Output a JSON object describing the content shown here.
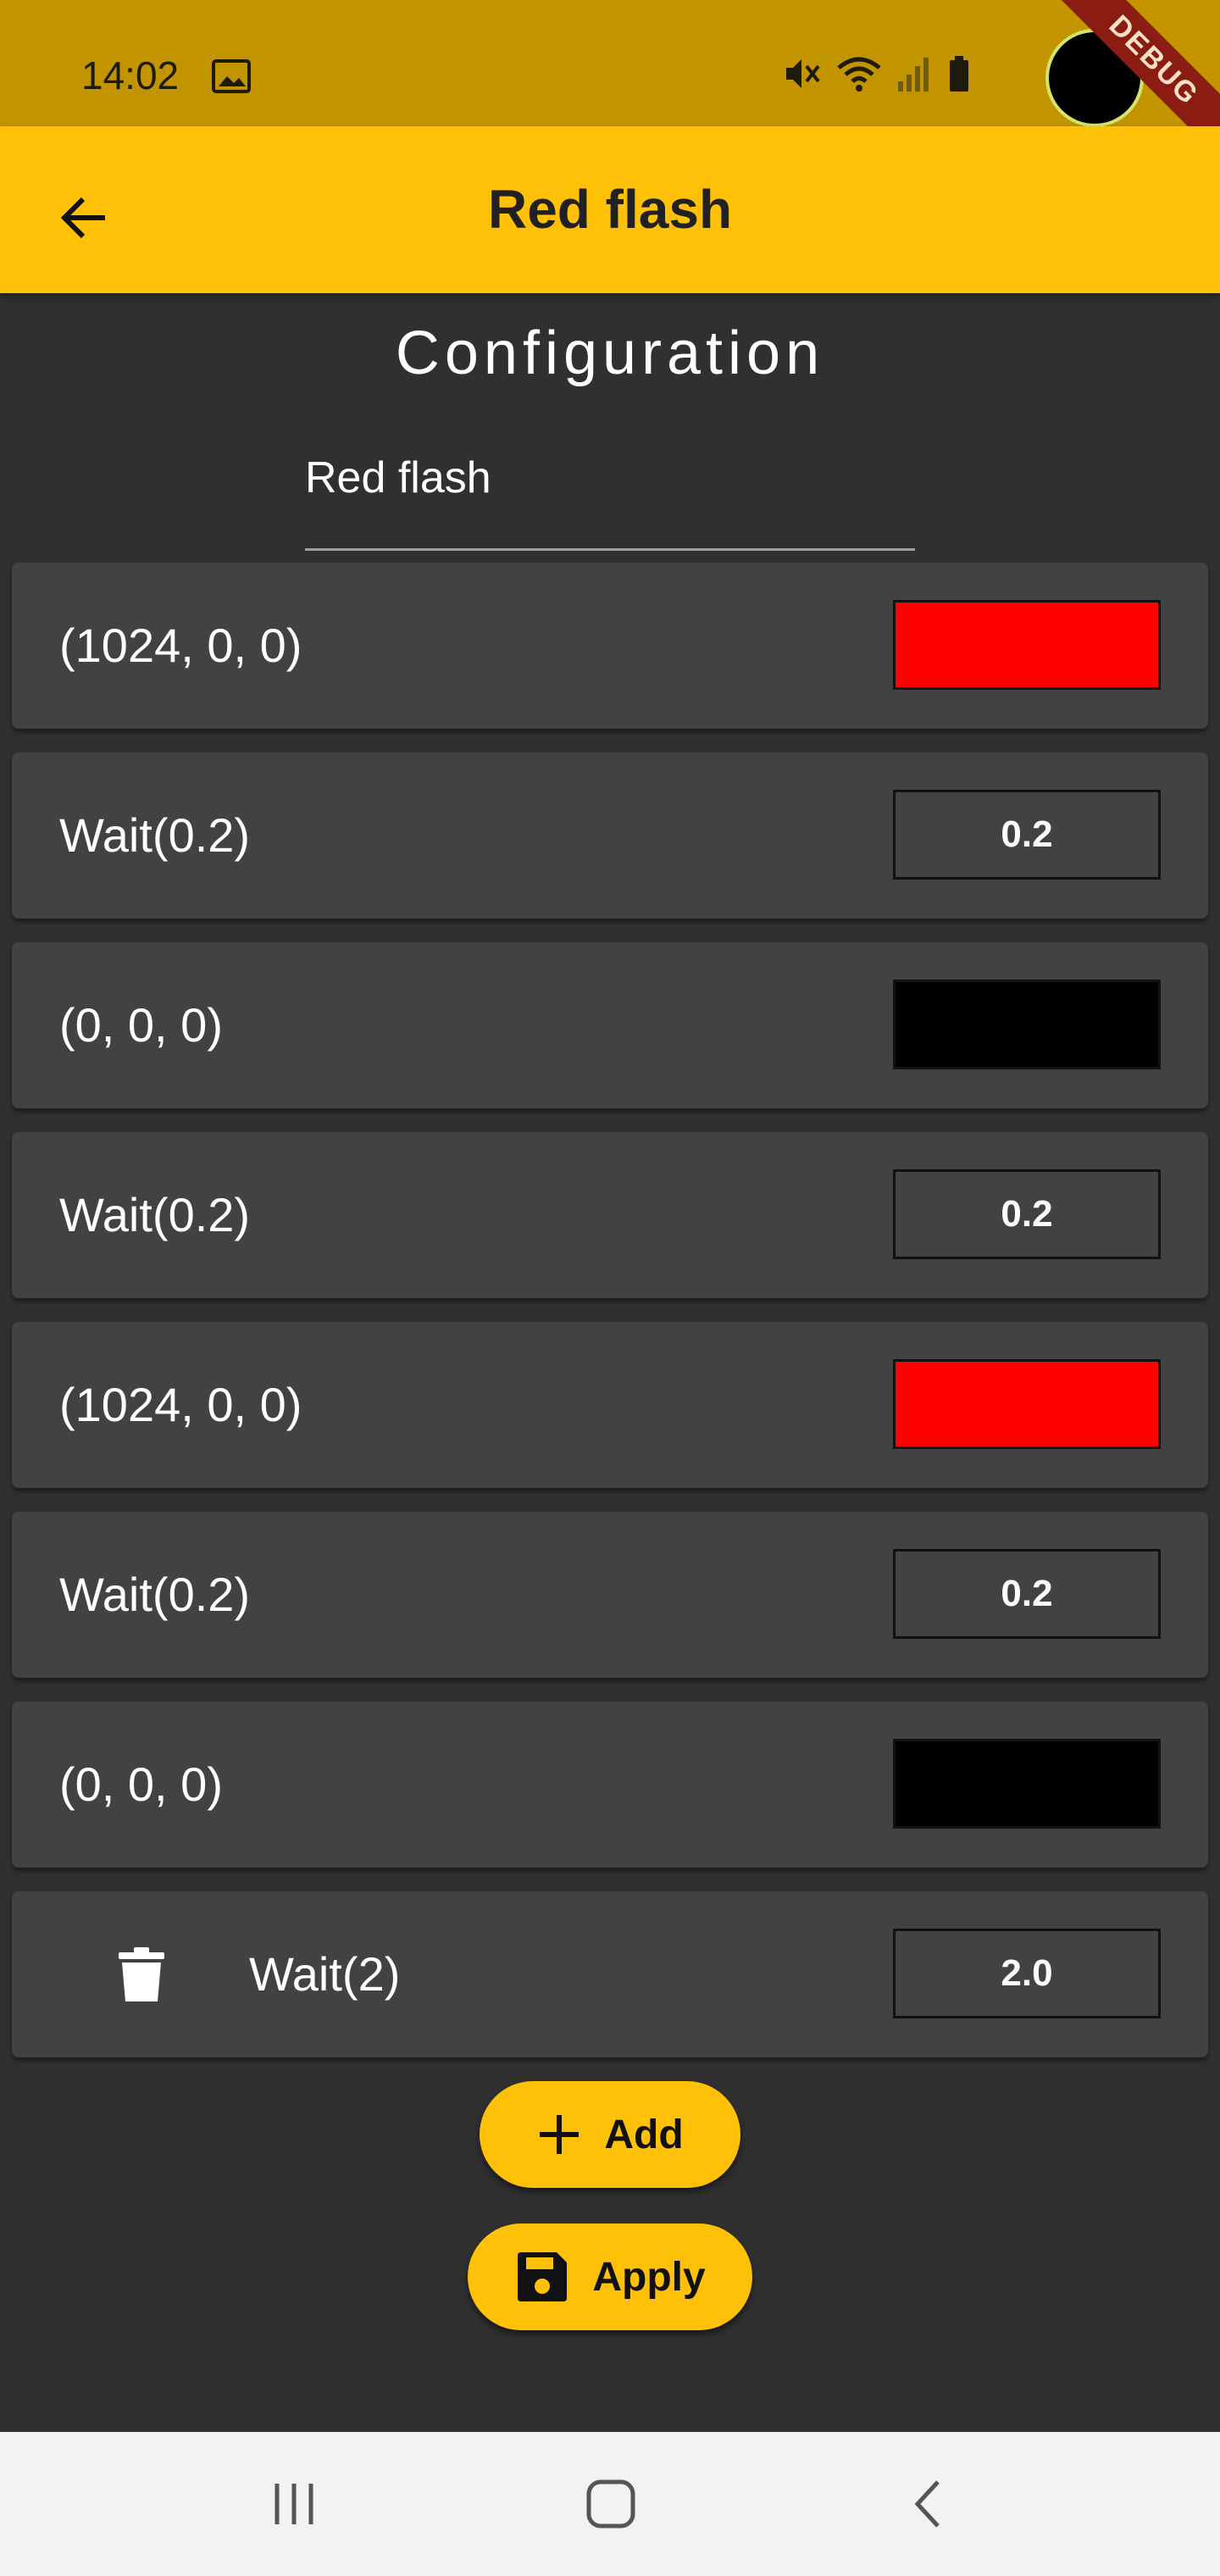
{
  "status_bar": {
    "time": "14:02",
    "debug_banner": "DEBUG"
  },
  "app_bar": {
    "title": "Red flash"
  },
  "config": {
    "section_title": "Configuration",
    "name_value": "Red flash"
  },
  "steps": [
    {
      "label": "(1024, 0, 0)",
      "type": "color",
      "color": "#ff0000"
    },
    {
      "label": "Wait(0.2)",
      "type": "wait",
      "value": "0.2"
    },
    {
      "label": "(0, 0, 0)",
      "type": "color",
      "color": "#000000"
    },
    {
      "label": "Wait(0.2)",
      "type": "wait",
      "value": "0.2"
    },
    {
      "label": "(1024, 0, 0)",
      "type": "color",
      "color": "#ff0000"
    },
    {
      "label": "Wait(0.2)",
      "type": "wait",
      "value": "0.2"
    },
    {
      "label": "(0, 0, 0)",
      "type": "color",
      "color": "#000000"
    },
    {
      "label": "Wait(2)",
      "type": "wait",
      "value": "2.0",
      "deletable": true
    }
  ],
  "actions": {
    "add_label": "Add",
    "apply_label": "Apply"
  },
  "colors": {
    "accent": "#ffc107",
    "status_bar": "#c29400",
    "background": "#303030",
    "card": "#424242"
  }
}
